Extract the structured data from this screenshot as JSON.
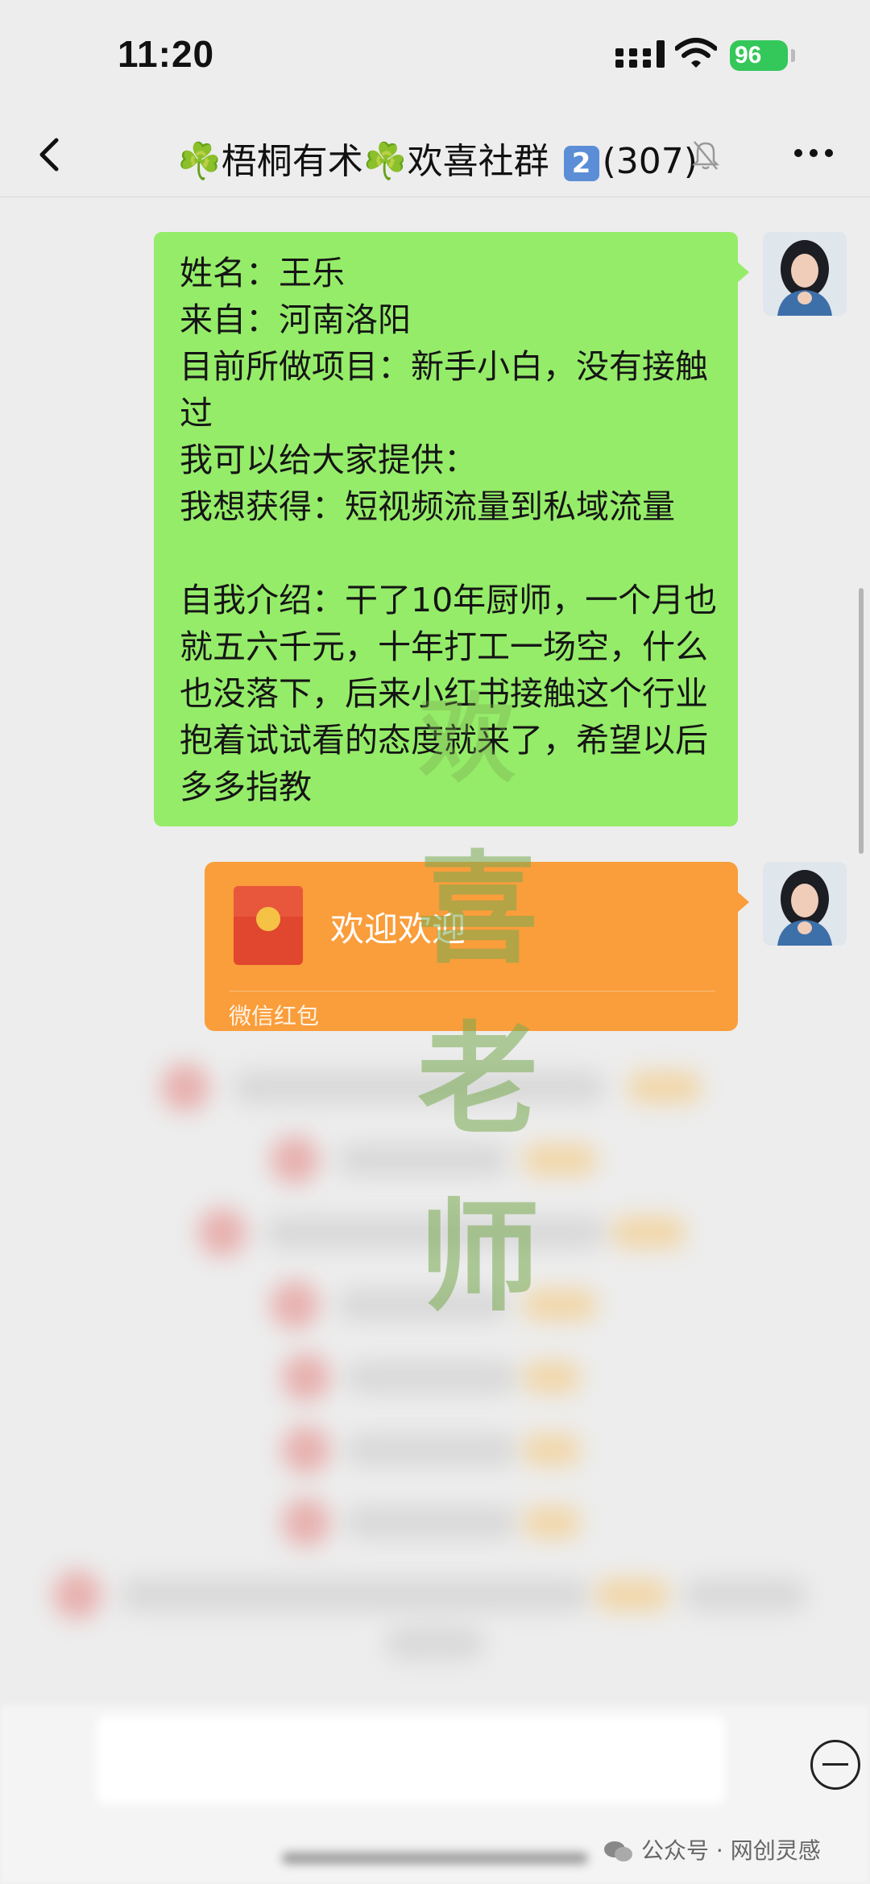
{
  "status_bar": {
    "time": "11:20",
    "battery": "96"
  },
  "header": {
    "title_clover1": "☘️",
    "title_text1": "梧桐有术",
    "title_clover2": "☘️",
    "title_text2": "欢喜社群",
    "title_badge": "2",
    "member_count": "(307)"
  },
  "messages": [
    {
      "type": "text",
      "text": "姓名：王乐\n来自：河南洛阳\n目前所做项目：新手小白，没有接触过\n我可以给大家提供：\n我想获得：短视频流量到私域流量\n\n自我介绍：干了10年厨师，一个月也就五六千元，十年打工一场空，什么也没落下，后来小红书接触这个行业抱着试试看的态度就来了，希望以后多多指教"
    },
    {
      "type": "red_packet",
      "title": "欢迎欢迎",
      "footer": "微信红包"
    }
  ],
  "watermark": {
    "chars": [
      "欢",
      "喜",
      "老",
      "师"
    ]
  },
  "footer_mark": {
    "text": "公众号 · 网创灵感"
  },
  "colors": {
    "bubble": "#95ec69",
    "red_packet": "#fa9d3b",
    "battery": "#34c759"
  }
}
